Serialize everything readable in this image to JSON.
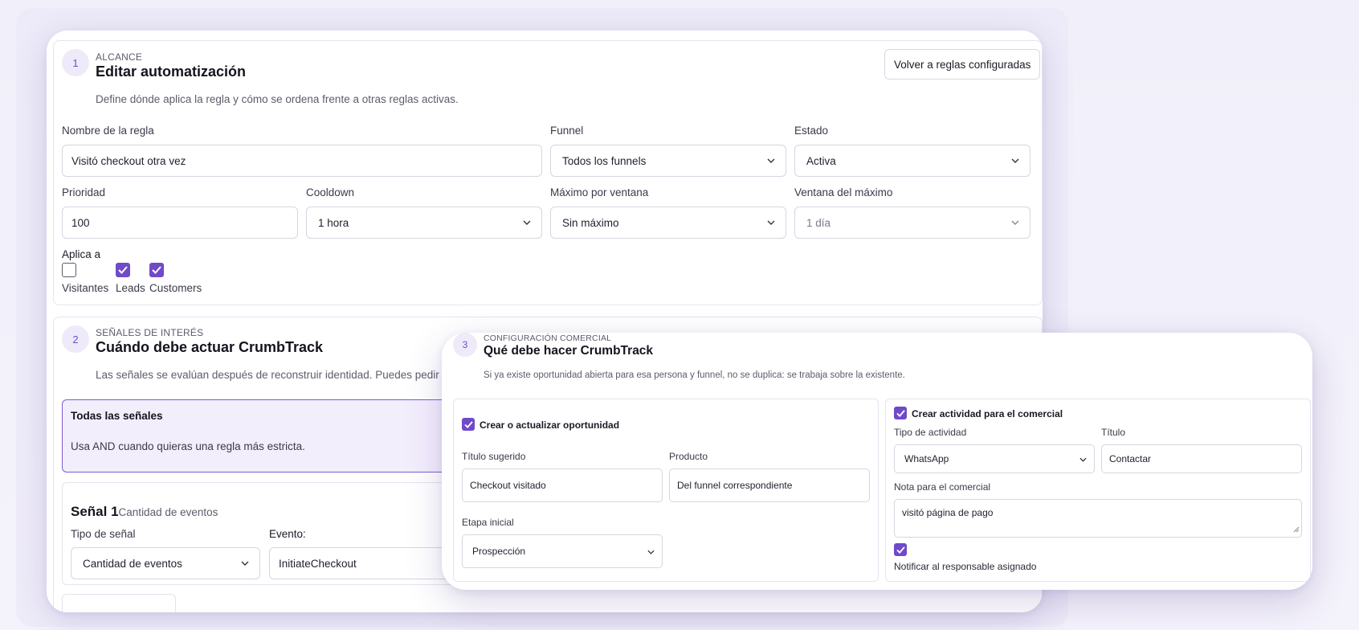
{
  "scope": {
    "step": "1",
    "eyebrow": "ALCANCE",
    "title": "Editar automatización",
    "description": "Define dónde aplica la regla y cómo se ordena frente a otras reglas activas.",
    "back_button": "Volver a reglas configuradas",
    "rule_name_label": "Nombre de la regla",
    "rule_name_value": "Visitó checkout otra vez",
    "funnel_label": "Funnel",
    "funnel_value": "Todos los funnels",
    "status_label": "Estado",
    "status_value": "Activa",
    "priority_label": "Prioridad",
    "priority_value": "100",
    "cooldown_label": "Cooldown",
    "cooldown_value": "1 hora",
    "max_label": "Máximo por ventana",
    "max_value": "Sin máximo",
    "window_label": "Ventana del máximo",
    "window_value": "1 día",
    "applies_label": "Aplica a",
    "applies": [
      {
        "label": "Visitantes",
        "checked": false
      },
      {
        "label": "Leads",
        "checked": true
      },
      {
        "label": "Customers",
        "checked": true
      }
    ]
  },
  "signals": {
    "step": "2",
    "eyebrow": "SEÑALES DE INTERÉS",
    "title": "Cuándo debe actuar CrumbTrack",
    "description": "Las señales se evalúan después de reconstruir identidad. Puedes pedir q",
    "all_title": "Todas las señales",
    "all_desc": "Usa AND cuando quieras una regla más estricta.",
    "signal_title": "Señal 1",
    "signal_sub": "Cantidad de eventos",
    "type_label": "Tipo de señal",
    "type_value": "Cantidad de eventos",
    "event_label": "Evento:",
    "event_value": "InitiateCheckout"
  },
  "commercial": {
    "step": "3",
    "eyebrow": "CONFIGURACIÓN COMERCIAL",
    "title": "Qué debe hacer CrumbTrack",
    "description": "Si ya existe oportunidad abierta para esa persona y funnel, no se duplica: se trabaja sobre la existente.",
    "opp_checkbox": "Crear o actualizar oportunidad",
    "suggested_title_label": "Título sugerido",
    "suggested_title_value": "Checkout visitado",
    "product_label": "Producto",
    "product_value": "Del funnel correspondiente",
    "stage_label": "Etapa inicial",
    "stage_value": "Prospección",
    "activity_checkbox": "Crear actividad para el comercial",
    "activity_type_label": "Tipo de actividad",
    "activity_type_value": "WhatsApp",
    "activity_title_label": "Título",
    "activity_title_value": "Contactar",
    "note_label": "Nota para el comercial",
    "note_value": "visitó página de pago",
    "notify_label": "Notificar al responsable asignado"
  },
  "colors": {
    "accent": "#6f4ac9",
    "accent_soft": "#efeaf9"
  }
}
